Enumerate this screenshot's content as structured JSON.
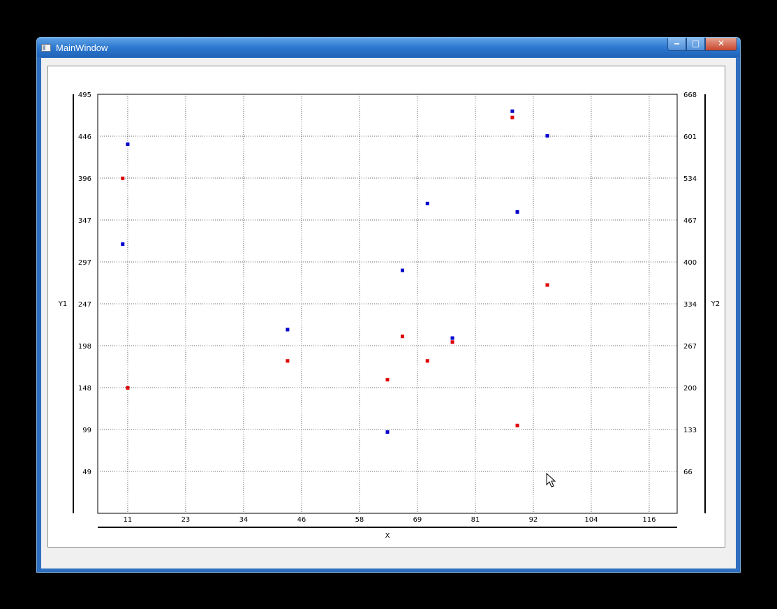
{
  "window": {
    "title": "MainWindow",
    "controls": {
      "minimize": "‒",
      "maximize": "□",
      "close": "✕"
    }
  },
  "chart_data": {
    "type": "scatter",
    "title": "",
    "xlabel": "X",
    "ylabel": "Y1",
    "y2label": "Y2",
    "xlim": [
      5,
      121
    ],
    "ylim": [
      0,
      495
    ],
    "y2lim": [
      0,
      668
    ],
    "x_ticks": [
      11,
      23,
      34,
      46,
      58,
      69,
      81,
      92,
      104,
      116
    ],
    "x_tick_values": [
      11,
      22.6,
      34.2,
      45.8,
      57.4,
      69,
      80.6,
      92.2,
      103.8,
      115.4
    ],
    "y_ticks": [
      49,
      99,
      148,
      198,
      247,
      297,
      347,
      396,
      446,
      495
    ],
    "y_tick_values": [
      49.5,
      99,
      148.5,
      198,
      247.5,
      297,
      346.5,
      396,
      445.5,
      495
    ],
    "y2_ticks": [
      66,
      133,
      200,
      267,
      334,
      400,
      467,
      534,
      601,
      668
    ],
    "y2_tick_values": [
      66.8,
      133.6,
      200.4,
      267.2,
      334,
      400.8,
      467.6,
      534.4,
      601.2,
      668
    ],
    "grid": true,
    "series": [
      {
        "color": "#0000cc",
        "axis": "y1",
        "x": [
          11,
          10,
          43,
          66,
          71,
          76,
          88,
          89,
          95,
          63
        ],
        "y": [
          436,
          318,
          217,
          287,
          366,
          207,
          475,
          356,
          446,
          96
        ]
      },
      {
        "color": "#dd0000",
        "axis": "y2",
        "x": [
          10,
          11,
          43,
          66,
          71,
          76,
          88,
          89,
          95,
          63
        ],
        "y": [
          534,
          200,
          243,
          282,
          243,
          273,
          631,
          140,
          364,
          213
        ]
      }
    ]
  }
}
